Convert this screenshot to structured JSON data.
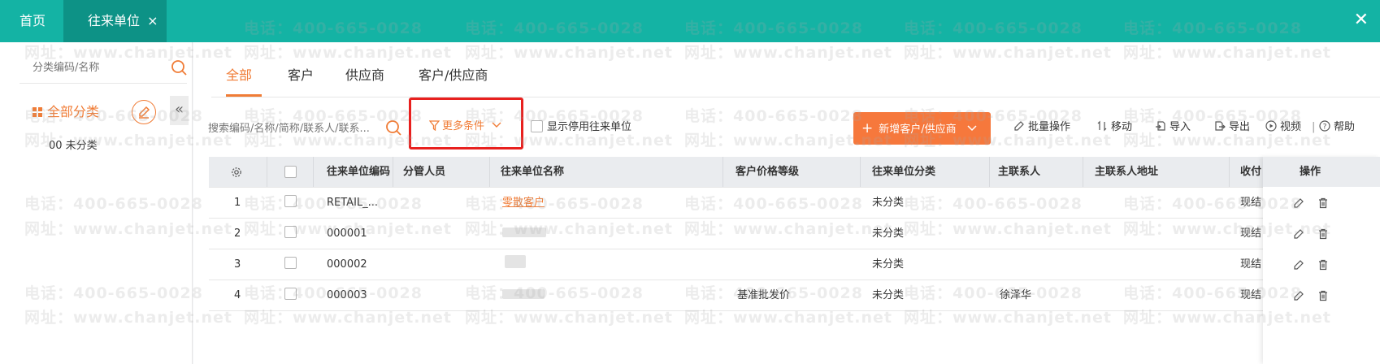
{
  "tabs": {
    "home_label": "首页",
    "active_label": "往来单位",
    "close_glyph": "×",
    "window_close_glyph": "✕"
  },
  "sidebar": {
    "search_placeholder": "分类编码/名称",
    "all_category_label": "全部分类",
    "collapse_glyph": "«",
    "items": [
      {
        "label": "00 未分类"
      }
    ]
  },
  "main": {
    "subtabs": [
      {
        "label": "全部",
        "active": true
      },
      {
        "label": "客户",
        "active": false
      },
      {
        "label": "供应商",
        "active": false
      },
      {
        "label": "客户/供应商",
        "active": false
      }
    ],
    "search_placeholder": "搜索编码/名称/简称/联系人/联系...",
    "more_filter_label": "更多条件",
    "show_disabled_label": "显示停用往来单位",
    "add_button_label": "新增客户/供应商",
    "tools": {
      "batch": "批量操作",
      "move": "移动",
      "import": "导入",
      "export": "导出",
      "video": "视频",
      "separator": "|",
      "help": "帮助"
    }
  },
  "table": {
    "columns": [
      "往来单位编码",
      "分管人员",
      "往来单位名称",
      "客户价格等级",
      "往来单位分类",
      "主联系人",
      "主联系人地址",
      "收付",
      "操作"
    ],
    "rows": [
      {
        "index": "1",
        "code": "RETAIL_...",
        "manager": "",
        "name": "零散客户",
        "price_level": "",
        "category": "未分类",
        "contact": "",
        "address": "",
        "payment": "现结"
      },
      {
        "index": "2",
        "code": "000001",
        "manager": "",
        "name": "",
        "price_level": "",
        "category": "未分类",
        "contact": "",
        "address": "",
        "payment": "现结"
      },
      {
        "index": "3",
        "code": "000002",
        "manager": "",
        "name": "",
        "price_level": "",
        "category": "未分类",
        "contact": "",
        "address": "",
        "payment": "现结"
      },
      {
        "index": "4",
        "code": "000003",
        "manager": "",
        "name": "",
        "price_level": "基准批发价",
        "category": "未分类",
        "contact": "徐泽华",
        "address": "",
        "payment": "现结"
      }
    ]
  },
  "watermark": {
    "phone": "电话：400-665-0028",
    "site": "网址：www.chanjet.net"
  },
  "colors": {
    "header": "#14b3a4",
    "header_active_tab": "#0d9286",
    "accent": "#f07c36",
    "primary_button": "#f6783c",
    "highlight_box": "#e8201e"
  }
}
